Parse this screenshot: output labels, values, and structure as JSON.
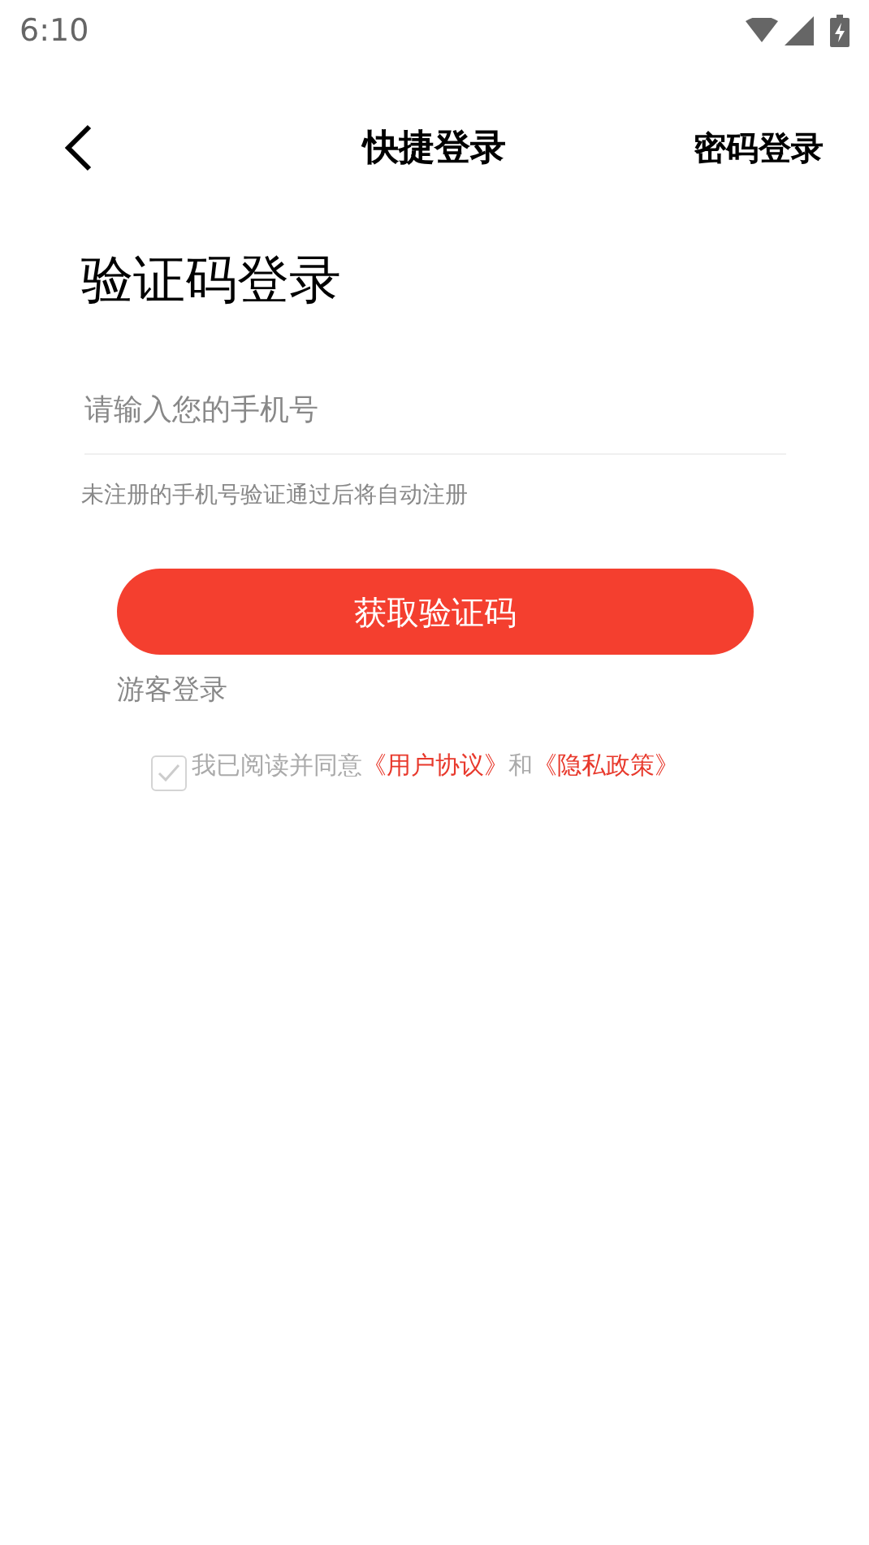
{
  "status_bar": {
    "time": "6:10"
  },
  "header": {
    "title": "快捷登录",
    "action": "密码登录"
  },
  "heading": "验证码登录",
  "phone_field": {
    "placeholder": "请输入您的手机号"
  },
  "hint": "未注册的手机号验证通过后将自动注册",
  "submit_button": "获取验证码",
  "guest_link": "游客登录",
  "agreement": {
    "checked": false,
    "parts": [
      {
        "kind": "text",
        "text": "我已阅读并同意"
      },
      {
        "kind": "link",
        "text": "《用户协议》"
      },
      {
        "kind": "text",
        "text": "和"
      },
      {
        "kind": "link",
        "text": "《隐私政策》"
      }
    ]
  }
}
